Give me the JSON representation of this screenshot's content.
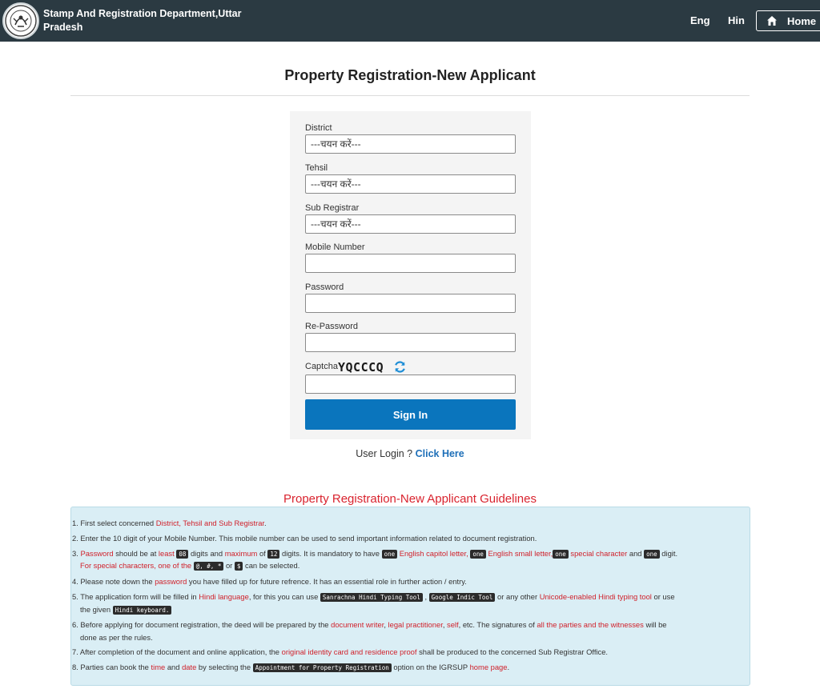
{
  "header": {
    "department": "Stamp And Registration Department,Uttar Pradesh",
    "lang_eng": "Eng",
    "lang_hin": "Hin",
    "home": "Home"
  },
  "page_title": "Property Registration-New Applicant",
  "form": {
    "district_label": "District",
    "district_value": "---चयन करें---",
    "tehsil_label": "Tehsil",
    "tehsil_value": "---चयन करें---",
    "sub_registrar_label": "Sub Registrar",
    "sub_registrar_value": "---चयन करें---",
    "mobile_label": "Mobile Number",
    "password_label": "Password",
    "repassword_label": "Re-Password",
    "captcha_label": "Captcha",
    "captcha_code": "YQCCCQ",
    "signin": "Sign In"
  },
  "user_login": {
    "text": "User Login ?",
    "link": "Click Here"
  },
  "guidelines": {
    "title": "Property Registration-New Applicant Guidelines",
    "g1": {
      "a": "1. First select concerned ",
      "b": "District, Tehsil and Sub Registrar",
      "c": "."
    },
    "g2": "2. Enter the 10 digit of your Mobile Number. This mobile number can be used to send important information related to document registration.",
    "g3": {
      "a": "3. ",
      "b": "Password",
      "c": " should be at ",
      "d": "least",
      "e": "08",
      "f": " digits and ",
      "g": "maximum",
      "h": " of ",
      "i": "12",
      "j": " digits. It is mandatory to have ",
      "k": "one",
      "l": " English capitol letter,",
      "m": "one",
      "n": " English small letter,",
      "o": "one",
      "p": " special character",
      "q": " and ",
      "s": "one",
      "t": " digit."
    },
    "g3b": {
      "a": "For special characters, one of the ",
      "b": "@, #, *",
      "c": " or ",
      "d": "$",
      "e": " can be selected."
    },
    "g4": {
      "a": "4. Please note down the ",
      "b": "password",
      "c": " you have filled up for future refrence. It has an essential role in further action / entry."
    },
    "g5": {
      "a": "5. The application form will be filled in ",
      "b": "Hindi language",
      "c": ", for this you can use ",
      "d": "Sanrachna Hindi Typing Tool",
      "e": " , ",
      "f": "Google Indic Tool",
      "g": " or any other ",
      "h": "Unicode-enabled Hindi typing tool",
      "i": " or use"
    },
    "g5b": {
      "a": "the given ",
      "b": "Hindi keyboard."
    },
    "g6": {
      "a": "6. Before applying for document registration, the deed will be prepared by the ",
      "b": "document writer",
      "c": ", ",
      "d": "legal practitioner",
      "e": ", ",
      "f": "self",
      "g": ", etc. The signatures of ",
      "h": "all the parties and the witnesses",
      "i": " will be"
    },
    "g6b": "done as per the rules.",
    "g7": {
      "a": "7. After completion of the document and online application, the ",
      "b": "original identity card and residence proof",
      "c": " shall be produced to the concerned Sub Registrar Office."
    },
    "g8": {
      "a": "8. Parties can book the ",
      "b": "time",
      "c": " and ",
      "d": "date",
      "e": " by selecting the ",
      "f": "Appointment for Property Registration",
      "g": " option on the IGRSUP ",
      "h": "home page",
      "i": "."
    }
  },
  "colors": {
    "header_bg": "#2b3a42",
    "accent_red": "#d0212b",
    "button_blue": "#0a75bd",
    "guide_bg": "#daeef5"
  },
  "icons": {
    "logo": "up-emblem-logo",
    "home": "home-icon",
    "refresh": "refresh-icon"
  }
}
